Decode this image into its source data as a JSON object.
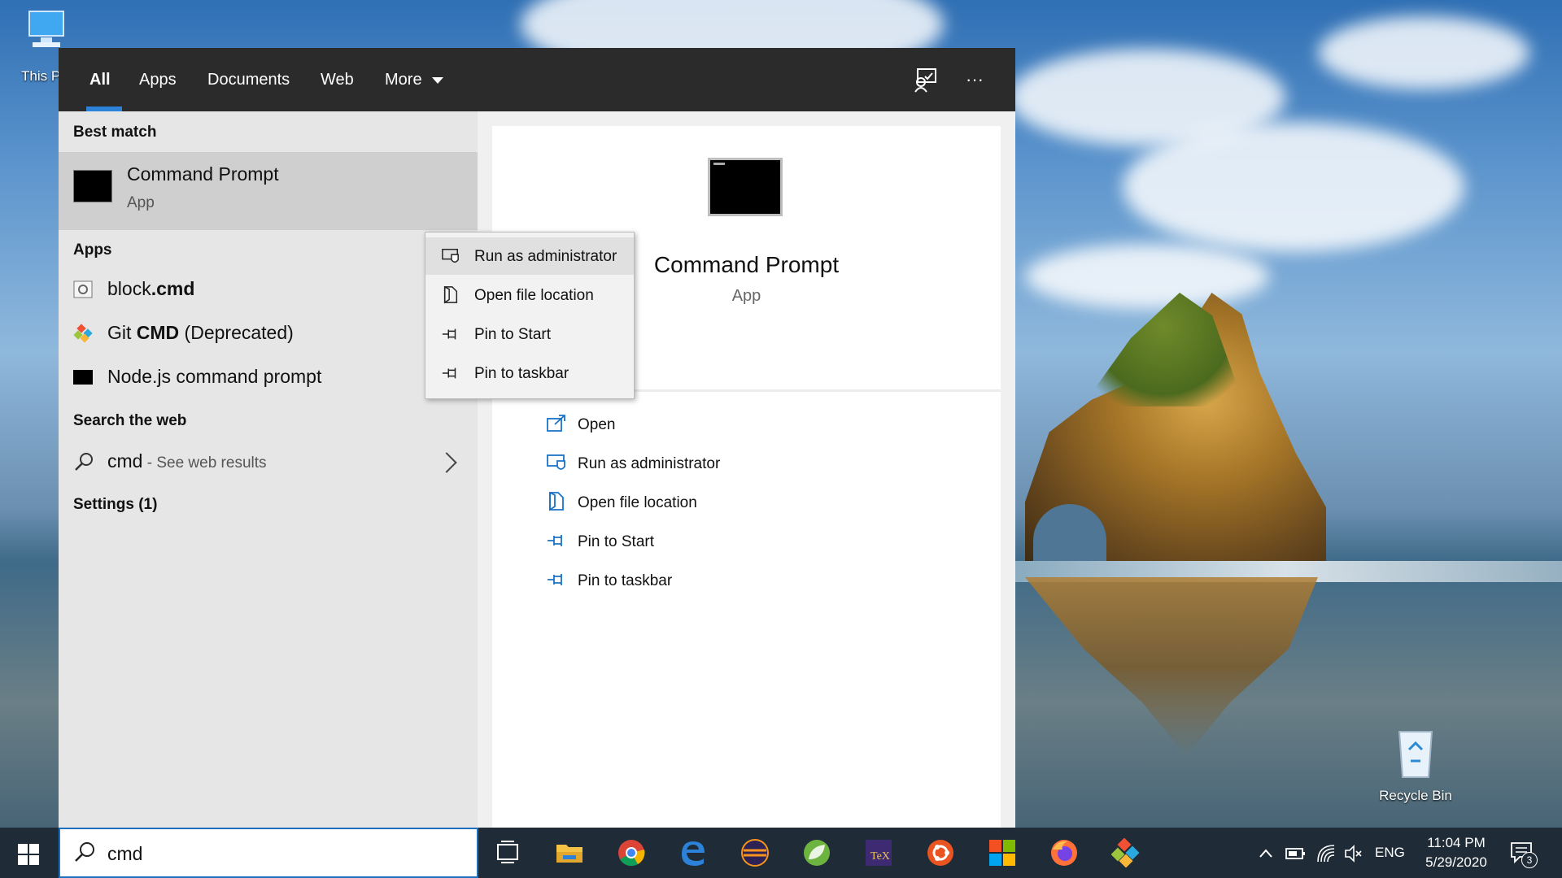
{
  "desktop": {
    "this_pc_label": "This P",
    "recycle_bin_label": "Recycle Bin"
  },
  "search_panel": {
    "tabs": [
      {
        "label": "All",
        "active": true
      },
      {
        "label": "Apps",
        "active": false
      },
      {
        "label": "Documents",
        "active": false
      },
      {
        "label": "Web",
        "active": false
      },
      {
        "label": "More",
        "active": false
      }
    ],
    "feedback_icon": "feedback-icon",
    "more_options_label": "···",
    "best_match_heading": "Best match",
    "best_match": {
      "title": "Command Prompt",
      "subtitle": "App"
    },
    "apps_heading": "Apps",
    "apps": [
      {
        "name_plain": "block",
        "name_bold": ".cmd"
      },
      {
        "name_plain": "Git ",
        "name_bold": "CMD",
        "name_suffix": " (Deprecated)"
      },
      {
        "name_plain": "Node.js command prompt",
        "name_bold": "",
        "name_suffix": ""
      }
    ],
    "web_heading": "Search the web",
    "web_result": {
      "query": "cmd",
      "suffix": " - See web results"
    },
    "settings_heading": "Settings (1)",
    "context_menu": [
      {
        "label": "Run as administrator",
        "icon": "shield-icon",
        "highlighted": true
      },
      {
        "label": "Open file location",
        "icon": "file-location-icon",
        "highlighted": false
      },
      {
        "label": "Pin to Start",
        "icon": "pin-icon",
        "highlighted": false
      },
      {
        "label": "Pin to taskbar",
        "icon": "pin-icon",
        "highlighted": false
      }
    ],
    "details": {
      "title": "Command Prompt",
      "subtitle": "App",
      "actions": [
        {
          "label": "Open",
          "icon": "open-icon"
        },
        {
          "label": "Run as administrator",
          "icon": "shield-icon"
        },
        {
          "label": "Open file location",
          "icon": "file-location-icon"
        },
        {
          "label": "Pin to Start",
          "icon": "pin-icon"
        },
        {
          "label": "Pin to taskbar",
          "icon": "pin-icon"
        }
      ]
    }
  },
  "taskbar": {
    "search_value": "cmd",
    "apps": [
      "task-view-icon",
      "file-explorer-icon",
      "chrome-icon",
      "edge-icon",
      "eclipse-icon",
      "spring-icon",
      "tex-icon",
      "ubuntu-icon",
      "office-icon",
      "firefox-icon",
      "git-icon"
    ],
    "language": "ENG",
    "time": "11:04 PM",
    "date": "5/29/2020",
    "notification_count": "3"
  },
  "colors": {
    "accent": "#2b82d8",
    "panel_dark": "#2b2b2b",
    "taskbar": "#1f2b36"
  }
}
